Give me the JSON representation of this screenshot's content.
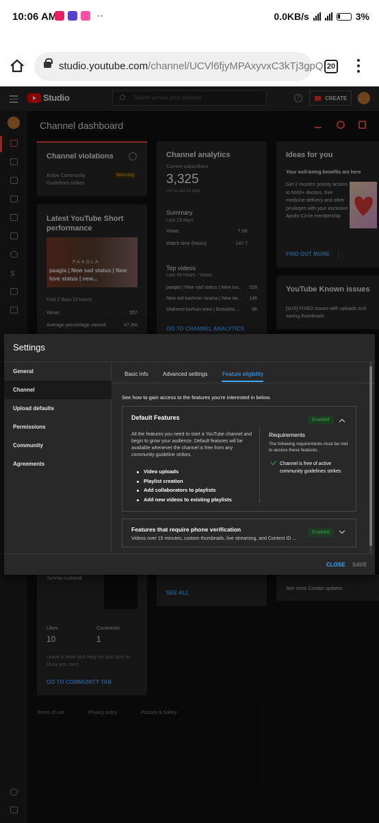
{
  "status_bar": {
    "time": "10:06 AM",
    "network_speed": "0.0KB/s",
    "battery": "3%"
  },
  "browser": {
    "url_host": "studio.youtube.com",
    "url_path": "/channel/UCVl6fjyMPAxyvxC3kTj3gpQ",
    "tab_count": "20"
  },
  "studio_header": {
    "logo_text": "Studio",
    "search_placeholder": "Search across your channel",
    "create_label": "CREATE"
  },
  "dashboard": {
    "title": "Channel dashboard",
    "violations": {
      "title": "Channel violations",
      "row_label": "Active Community Guidelines strikes",
      "row_status": "Warning"
    },
    "short": {
      "title": "Latest YouTube Short performance",
      "thumb_text": "paagla | New sad status | New love status | new...",
      "brand": "PAAGLA",
      "period": "First 2 days 15 hours:",
      "views_label": "Views",
      "views_value": "557",
      "avg_label": "Average percentage viewed",
      "avg_value": "47.3%"
    },
    "analytics": {
      "title": "Channel analytics",
      "subs_label": "Current subscribers",
      "subs_value": "3,325",
      "subs_delta": "+67 in last 28 days",
      "summary_title": "Summary",
      "summary_period": "Last 28 days",
      "views_label": "Views",
      "views_value": "7.6K",
      "watch_label": "Watch time (hours)",
      "watch_value": "147.7",
      "top_title": "Top videos",
      "top_period": "Last 48 hours · Views",
      "top_videos": [
        {
          "title": "paagla | New sad status | New lov...",
          "views": "528"
        },
        {
          "title": "New eid kashmiri tarana | New tar...",
          "views": "146"
        },
        {
          "title": "shaheed burhan wani | Beautiful ...",
          "views": "96"
        }
      ],
      "link": "GO TO CHANNEL ANALYTICS"
    },
    "ideas": {
      "title": "Ideas for you",
      "subtitle": "Your well-being benefits are here",
      "body": "Get 2 months' priority access to 5000+ doctors, free medicine delivery and other privileges with your exclusive Apollo Circle membership",
      "link": "FIND OUT MORE"
    },
    "known_issues": {
      "title": "YouTube Known issues",
      "body": "[9/15] FIXED Issues with uploads and saving thumbnails"
    },
    "community": {
      "post_text": "Jumma mubarak",
      "likes_label": "Likes",
      "likes_value": "10",
      "comments_label": "Comments",
      "comments_value": "1",
      "hint": "Leave a heart and reply on your post to show you care!",
      "link": "GO TO COMMUNITY TAB"
    },
    "see_all": "SEE ALL",
    "creator_updates": "See more Creator updates",
    "footer": [
      "Terms of use",
      "Privacy policy",
      "Policies & Safety"
    ]
  },
  "settings": {
    "title": "Settings",
    "nav": [
      "General",
      "Channel",
      "Upload defaults",
      "Permissions",
      "Community",
      "Agreements"
    ],
    "active_nav": "Channel",
    "tabs": [
      "Basic info",
      "Advanced settings",
      "Feature eligibility"
    ],
    "active_tab": "Feature eligibility",
    "intro": "See how to gain access to the features you're interested in below.",
    "default_features": {
      "title": "Default Features",
      "badge": "Enabled",
      "description": "All the features you need to start a YouTube channel and begin to grow your audience. Default features will be available whenever the channel is free from any community guideline strikes.",
      "features": [
        "Video uploads",
        "Playlist creation",
        "Add collaborators to playlists",
        "Add new videos to existing playlists"
      ],
      "req_title": "Requirements",
      "req_desc": "The following requirements must be met to access these features.",
      "req_item": "Channel is free of active community guidelines strikes"
    },
    "phone_features": {
      "title": "Features that require phone verification",
      "desc": "Videos over 15 minutes, custom thumbnails, live streaming, and Content ID ...",
      "badge": "Enabled"
    },
    "close_label": "CLOSE",
    "save_label": "SAVE"
  },
  "colors": {
    "accent_blue": "#3ea6ff",
    "enabled_green": "#2ba640",
    "warning_yellow": "#f4b400",
    "brand_red": "#ff0000"
  }
}
